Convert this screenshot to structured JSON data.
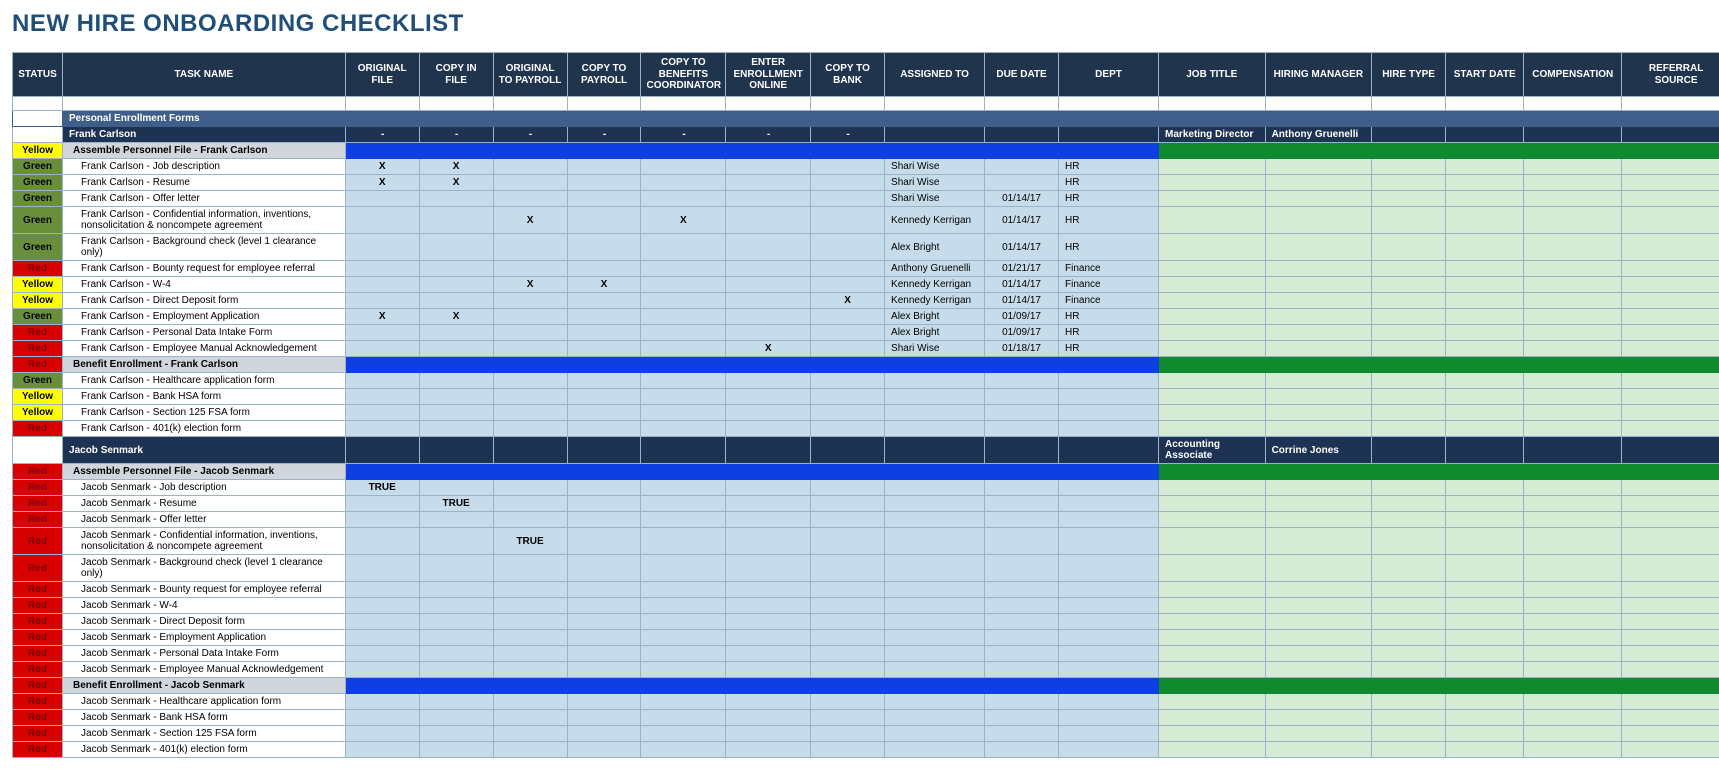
{
  "title": "NEW HIRE ONBOARDING CHECKLIST",
  "columns": [
    "STATUS",
    "TASK NAME",
    "ORIGINAL FILE",
    "COPY IN FILE",
    "ORIGINAL TO PAYROLL",
    "COPY TO PAYROLL",
    "COPY TO BENEFITS COORDINATOR",
    "ENTER ENROLLMENT ONLINE",
    "COPY TO BANK",
    "ASSIGNED TO",
    "DUE DATE",
    "DEPT",
    "JOB TITLE",
    "HIRING MANAGER",
    "HIRE TYPE",
    "START DATE",
    "COMPENSATION",
    "REFERRAL SOURCE"
  ],
  "rows": [
    {
      "type": "blankfirst"
    },
    {
      "type": "section",
      "label": "Personal Enrollment Forms"
    },
    {
      "type": "person",
      "name": "Frank Carlson",
      "mid": [
        "-",
        "-",
        "-",
        "-",
        "-",
        "-",
        "-",
        "",
        "",
        ""
      ],
      "jobTitle": "Marketing Director",
      "hiringManager": "Anthony Gruenelli"
    },
    {
      "type": "group",
      "status": "Yellow",
      "task": "Assemble Personnel File - Frank Carlson"
    },
    {
      "type": "task",
      "status": "Green",
      "task": "Frank Carlson - Job description",
      "cells": [
        "X",
        "X",
        "",
        "",
        "",
        "",
        "",
        "Shari Wise",
        "",
        "HR"
      ]
    },
    {
      "type": "task",
      "status": "Green",
      "task": "Frank Carlson - Resume",
      "cells": [
        "X",
        "X",
        "",
        "",
        "",
        "",
        "",
        "Shari Wise",
        "",
        "HR"
      ]
    },
    {
      "type": "task",
      "status": "Green",
      "task": "Frank Carlson - Offer letter",
      "cells": [
        "",
        "",
        "",
        "",
        "",
        "",
        "",
        "Shari Wise",
        "01/14/17",
        "HR"
      ]
    },
    {
      "type": "task",
      "status": "Green",
      "task": "Frank Carlson - Confidential information, inventions, nonsolicitation & noncompete agreement",
      "cells": [
        "",
        "",
        "X",
        "",
        "X",
        "",
        "",
        "Kennedy Kerrigan",
        "01/14/17",
        "HR"
      ]
    },
    {
      "type": "task",
      "status": "Green",
      "task": "Frank Carlson - Background check (level 1 clearance only)",
      "cells": [
        "",
        "",
        "",
        "",
        "",
        "",
        "",
        "Alex Bright",
        "01/14/17",
        "HR"
      ]
    },
    {
      "type": "task",
      "status": "Red",
      "task": "Frank Carlson - Bounty request for employee referral",
      "cells": [
        "",
        "",
        "",
        "",
        "",
        "",
        "",
        "Anthony Gruenelli",
        "01/21/17",
        "Finance"
      ]
    },
    {
      "type": "task",
      "status": "Yellow",
      "task": "Frank Carlson - W-4",
      "cells": [
        "",
        "",
        "X",
        "X",
        "",
        "",
        "",
        "Kennedy Kerrigan",
        "01/14/17",
        "Finance"
      ]
    },
    {
      "type": "task",
      "status": "Yellow",
      "task": "Frank Carlson - Direct Deposit form",
      "cells": [
        "",
        "",
        "",
        "",
        "",
        "",
        "X",
        "Kennedy Kerrigan",
        "01/14/17",
        "Finance"
      ]
    },
    {
      "type": "task",
      "status": "Green",
      "task": "Frank Carlson - Employment Application",
      "cells": [
        "X",
        "X",
        "",
        "",
        "",
        "",
        "",
        "Alex Bright",
        "01/09/17",
        "HR"
      ]
    },
    {
      "type": "task",
      "status": "Red",
      "task": "Frank Carlson - Personal Data Intake Form",
      "cells": [
        "",
        "",
        "",
        "",
        "",
        "",
        "",
        "Alex Bright",
        "01/09/17",
        "HR"
      ]
    },
    {
      "type": "task",
      "status": "Red",
      "task": "Frank Carlson - Employee Manual Acknowledgement",
      "cells": [
        "",
        "",
        "",
        "",
        "",
        "X",
        "",
        "Shari Wise",
        "01/18/17",
        "HR"
      ]
    },
    {
      "type": "group",
      "status": "Red",
      "task": "Benefit Enrollment - Frank Carlson"
    },
    {
      "type": "task",
      "status": "Green",
      "task": "Frank Carlson - Healthcare application form",
      "cells": [
        "",
        "",
        "",
        "",
        "",
        "",
        "",
        "",
        "",
        ""
      ]
    },
    {
      "type": "task",
      "status": "Yellow",
      "task": "Frank Carlson - Bank HSA form",
      "cells": [
        "",
        "",
        "",
        "",
        "",
        "",
        "",
        "",
        "",
        ""
      ]
    },
    {
      "type": "task",
      "status": "Yellow",
      "task": "Frank Carlson - Section 125 FSA form",
      "cells": [
        "",
        "",
        "",
        "",
        "",
        "",
        "",
        "",
        "",
        ""
      ]
    },
    {
      "type": "task",
      "status": "Red",
      "task": "Frank Carlson - 401(k) election form",
      "cells": [
        "",
        "",
        "",
        "",
        "",
        "",
        "",
        "",
        "",
        ""
      ]
    },
    {
      "type": "person",
      "name": "Jacob Senmark",
      "mid": [
        "",
        "",
        "",
        "",
        "",
        "",
        "",
        "",
        "",
        ""
      ],
      "jobTitle": "Accounting Associate",
      "hiringManager": "Corrine Jones"
    },
    {
      "type": "group",
      "status": "Red",
      "task": "Assemble Personnel File - Jacob Senmark"
    },
    {
      "type": "task",
      "status": "Red",
      "task": "Jacob Senmark - Job description",
      "cells": [
        "TRUE",
        "",
        "",
        "",
        "",
        "",
        "",
        "",
        "",
        ""
      ]
    },
    {
      "type": "task",
      "status": "Red",
      "task": "Jacob Senmark - Resume",
      "cells": [
        "",
        "TRUE",
        "",
        "",
        "",
        "",
        "",
        "",
        "",
        ""
      ]
    },
    {
      "type": "task",
      "status": "Red",
      "task": "Jacob Senmark - Offer letter",
      "cells": [
        "",
        "",
        "",
        "",
        "",
        "",
        "",
        "",
        "",
        ""
      ]
    },
    {
      "type": "task",
      "status": "Red",
      "task": "Jacob Senmark - Confidential information, inventions, nonsolicitation & noncompete agreement",
      "cells": [
        "",
        "",
        "TRUE",
        "",
        "",
        "",
        "",
        "",
        "",
        ""
      ]
    },
    {
      "type": "task",
      "status": "Red",
      "task": "Jacob Senmark - Background check (level 1 clearance only)",
      "cells": [
        "",
        "",
        "",
        "",
        "",
        "",
        "",
        "",
        "",
        ""
      ]
    },
    {
      "type": "task",
      "status": "Red",
      "task": "Jacob Senmark - Bounty request for employee referral",
      "cells": [
        "",
        "",
        "",
        "",
        "",
        "",
        "",
        "",
        "",
        ""
      ]
    },
    {
      "type": "task",
      "status": "Red",
      "task": "Jacob Senmark - W-4",
      "cells": [
        "",
        "",
        "",
        "",
        "",
        "",
        "",
        "",
        "",
        ""
      ]
    },
    {
      "type": "task",
      "status": "Red",
      "task": "Jacob Senmark - Direct Deposit form",
      "cells": [
        "",
        "",
        "",
        "",
        "",
        "",
        "",
        "",
        "",
        ""
      ]
    },
    {
      "type": "task",
      "status": "Red",
      "task": "Jacob Senmark - Employment Application",
      "cells": [
        "",
        "",
        "",
        "",
        "",
        "",
        "",
        "",
        "",
        ""
      ]
    },
    {
      "type": "task",
      "status": "Red",
      "task": "Jacob Senmark - Personal Data Intake Form",
      "cells": [
        "",
        "",
        "",
        "",
        "",
        "",
        "",
        "",
        "",
        ""
      ]
    },
    {
      "type": "task",
      "status": "Red",
      "task": "Jacob Senmark - Employee Manual Acknowledgement",
      "cells": [
        "",
        "",
        "",
        "",
        "",
        "",
        "",
        "",
        "",
        ""
      ]
    },
    {
      "type": "group",
      "status": "Red",
      "task": "Benefit Enrollment - Jacob Senmark"
    },
    {
      "type": "task",
      "status": "Red",
      "task": "Jacob Senmark - Healthcare application form",
      "cells": [
        "",
        "",
        "",
        "",
        "",
        "",
        "",
        "",
        "",
        ""
      ]
    },
    {
      "type": "task",
      "status": "Red",
      "task": "Jacob Senmark - Bank HSA form",
      "cells": [
        "",
        "",
        "",
        "",
        "",
        "",
        "",
        "",
        "",
        ""
      ]
    },
    {
      "type": "task",
      "status": "Red",
      "task": "Jacob Senmark - Section 125 FSA form",
      "cells": [
        "",
        "",
        "",
        "",
        "",
        "",
        "",
        "",
        "",
        ""
      ]
    },
    {
      "type": "task",
      "status": "Red",
      "task": "Jacob Senmark - 401(k) election form",
      "cells": [
        "",
        "",
        "",
        "",
        "",
        "",
        "",
        "",
        "",
        ""
      ]
    }
  ]
}
